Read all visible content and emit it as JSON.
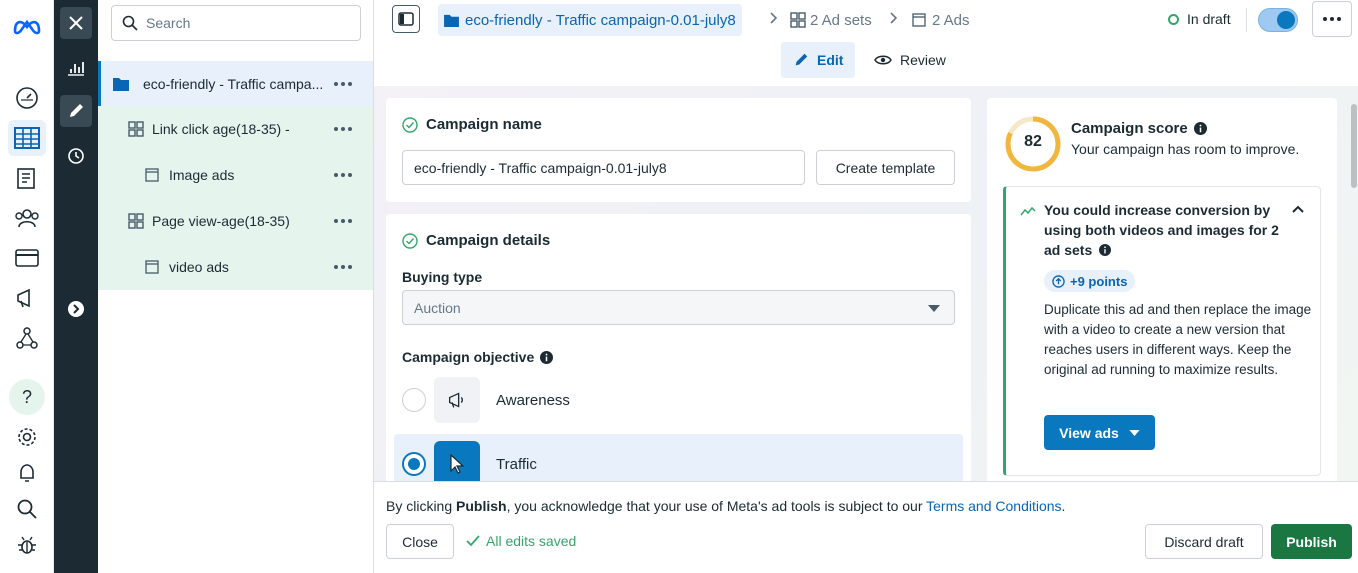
{
  "rail": {
    "items": [
      "meta-logo",
      "analytics",
      "dashboard",
      "campaigns-table",
      "pages",
      "audiences",
      "billing",
      "ads",
      "business-settings",
      "help",
      "settings",
      "notifications",
      "search",
      "bug-report"
    ],
    "help_symbol": "?"
  },
  "darkrail": {
    "items": [
      "close",
      "chart",
      "edit",
      "history",
      "expand"
    ]
  },
  "tree": {
    "search_placeholder": "Search",
    "items": [
      {
        "label": "eco-friendly - Traffic campa...",
        "type": "campaign"
      },
      {
        "label": "Link click age(18-35) -",
        "type": "adset"
      },
      {
        "label": "Image ads",
        "type": "ad"
      },
      {
        "label": "Page view-age(18-35)",
        "type": "adset"
      },
      {
        "label": "video ads",
        "type": "ad"
      }
    ]
  },
  "topbar": {
    "campaign": "eco-friendly - Traffic campaign-0.01-july8",
    "adsets": "2 Ad sets",
    "ads": "2 Ads",
    "status": "In draft",
    "tabs": [
      "Edit",
      "Review"
    ]
  },
  "campaign_name": {
    "title": "Campaign name",
    "value": "eco-friendly - Traffic campaign-0.01-july8",
    "template_button": "Create template"
  },
  "campaign_details": {
    "title": "Campaign details",
    "buying_type_label": "Buying type",
    "buying_type_value": "Auction",
    "objective_label": "Campaign objective",
    "objectives": [
      {
        "label": "Awareness",
        "selected": false
      },
      {
        "label": "Traffic",
        "selected": true
      }
    ]
  },
  "score": {
    "value": "82",
    "value_fraction": 0.82,
    "title": "Campaign score",
    "subtitle": "Your campaign has room to improve.",
    "recommendation": {
      "title": "You could increase conversion by using both videos and images for 2 ad sets",
      "points": "+9 points",
      "body": "Duplicate this ad and then replace the image with a video to create a new version that reaches users in different ways. Keep the original ad running to maximize results.",
      "button": "View ads"
    }
  },
  "footer": {
    "legal_prefix": "By clicking ",
    "legal_bold": "Publish",
    "legal_middle": ", you acknowledge that your use of Meta's ad tools is subject to our ",
    "legal_link": "Terms and Conditions",
    "legal_suffix": ".",
    "close": "Close",
    "saved": "All edits saved",
    "discard": "Discard draft",
    "publish": "Publish"
  },
  "colors": {
    "accent": "#0a78be",
    "publish": "#1a7741",
    "success": "#36a56c",
    "rail_dark": "#1c2b33"
  }
}
